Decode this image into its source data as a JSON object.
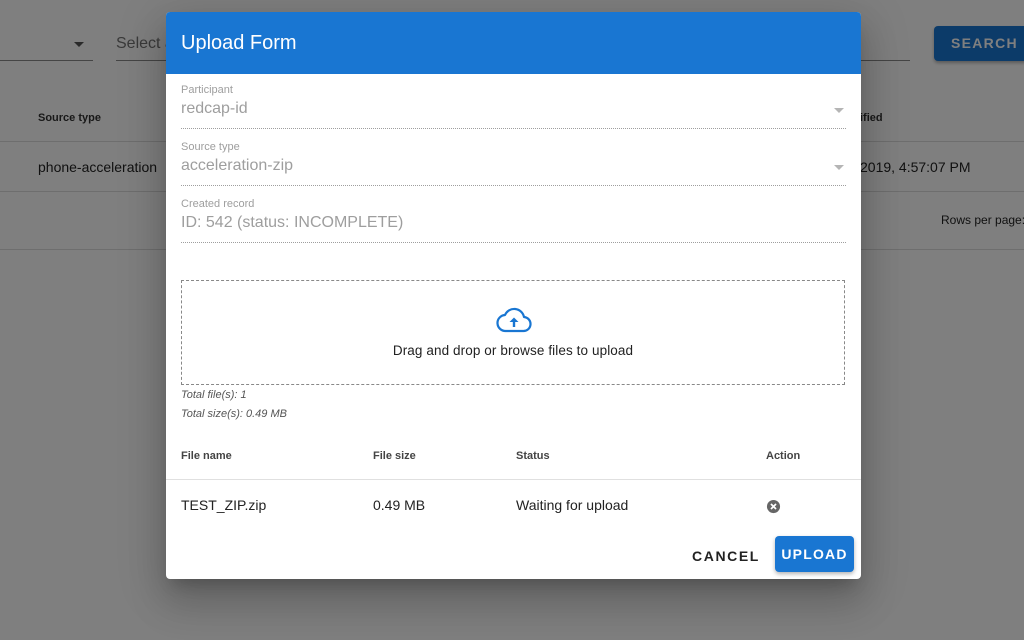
{
  "background": {
    "filter_select_placeholder": "Select a",
    "search_button_label": "SEARCH R",
    "table_headers": {
      "source_type": "Source type",
      "modified": "ified"
    },
    "row": {
      "source_type": "phone-acceleration",
      "modified": "2019, 4:57:07 PM"
    },
    "rows_per_page_label": "Rows per page:"
  },
  "dialog": {
    "title": "Upload Form",
    "fields": {
      "participant": {
        "label": "Participant",
        "value": "redcap-id"
      },
      "source_type": {
        "label": "Source type",
        "value": "acceleration-zip"
      },
      "created_record": {
        "label": "Created record",
        "value": "ID: 542 (status: INCOMPLETE)"
      }
    },
    "dropzone_text": "Drag and drop or browse files to upload",
    "total_files": "Total file(s): 1",
    "total_size": "Total size(s): 0.49 MB",
    "table": {
      "headers": {
        "file_name": "File name",
        "file_size": "File size",
        "status": "Status",
        "action": "Action"
      },
      "rows": [
        {
          "file_name": "TEST_ZIP.zip",
          "file_size": "0.49 MB",
          "status": "Waiting for upload"
        }
      ]
    },
    "cancel_label": "CANCEL",
    "upload_label": "UPLOAD"
  },
  "colors": {
    "primary": "#1976d2",
    "backdrop": "rgba(0,0,0,0.5)"
  },
  "icons": {
    "upload": "cloud-upload-icon",
    "remove": "remove-circle-icon",
    "dropdown": "chevron-down-icon"
  }
}
